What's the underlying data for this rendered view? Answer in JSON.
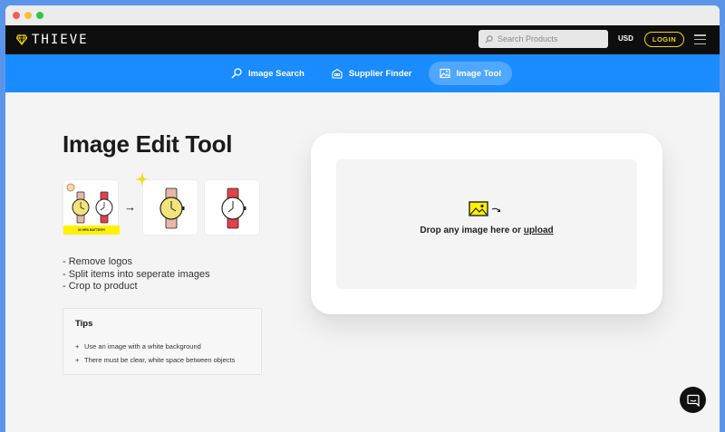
{
  "browser": {
    "controls": [
      "close",
      "minimize",
      "maximize"
    ]
  },
  "header": {
    "logo_text": "THIEVE",
    "logo_icon": "diamond-icon",
    "search": {
      "placeholder": "Search Products",
      "value": ""
    },
    "currency": "USD",
    "login_label": "LOGIN",
    "menu_icon": "hamburger-icon",
    "accent_color": "#f5d90a"
  },
  "subnav": {
    "background": "#1a8cff",
    "items": [
      {
        "label": "Image Search",
        "icon": "magnifier-icon",
        "active": false
      },
      {
        "label": "Supplier Finder",
        "icon": "warehouse-icon",
        "active": false
      },
      {
        "label": "Image Tool",
        "icon": "image-icon",
        "active": true
      }
    ]
  },
  "main": {
    "title": "Image Edit Tool",
    "example_banner": "30 HRS BATTERY!",
    "features": [
      "- Remove logos",
      "- Split items into seperate images",
      "- Crop to product"
    ],
    "tips": {
      "title": "Tips",
      "items": [
        "Use an image with a white background",
        "There must be clear, white space between objects"
      ],
      "bullet": "+"
    },
    "dropzone": {
      "text": "Drop any image here or",
      "link": "upload"
    }
  },
  "chat": {
    "icon": "chat-bubble-icon"
  }
}
